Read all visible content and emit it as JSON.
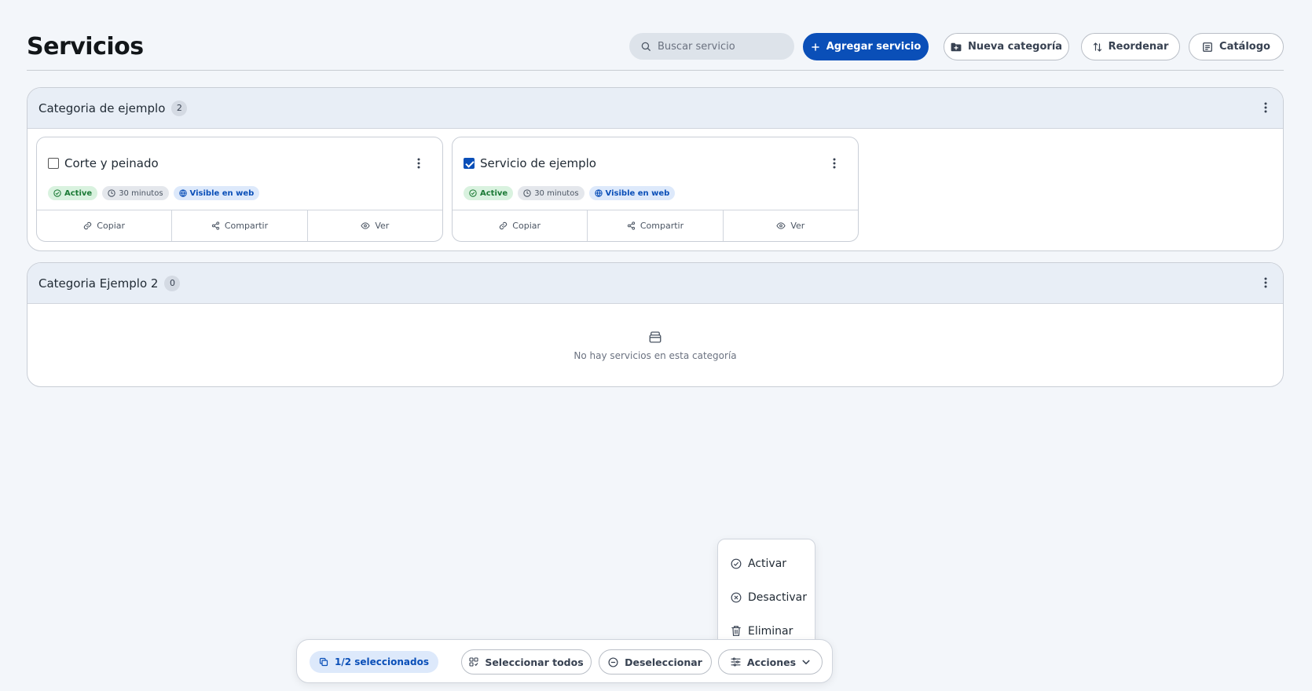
{
  "header": {
    "title": "Servicios",
    "search_placeholder": "Buscar servicio",
    "add_service": "Agregar servicio",
    "new_category": "Nueva categoría",
    "reorder": "Reordenar",
    "catalog": "Catálogo"
  },
  "categories": [
    {
      "title": "Categoria de ejemplo",
      "count": "2",
      "services": [
        {
          "title": "Corte y peinado",
          "checked": false,
          "status": "Active",
          "duration": "30 minutos",
          "visibility": "Visible en web",
          "actions": {
            "copy": "Copiar",
            "share": "Compartir",
            "view": "Ver"
          }
        },
        {
          "title": "Servicio de ejemplo",
          "checked": true,
          "status": "Active",
          "duration": "30 minutos",
          "visibility": "Visible en web",
          "actions": {
            "copy": "Copiar",
            "share": "Compartir",
            "view": "Ver"
          }
        }
      ]
    },
    {
      "title": "Categoria Ejemplo 2",
      "count": "0",
      "empty_text": "No hay servicios en esta categoría"
    }
  ],
  "actions_menu": {
    "items": [
      {
        "label": "Activar",
        "icon": "check-circle-icon"
      },
      {
        "label": "Desactivar",
        "icon": "x-circle-icon"
      },
      {
        "label": "Eliminar",
        "icon": "trash-icon"
      }
    ]
  },
  "selection_bar": {
    "count_label": "1/2 seleccionados",
    "select_all": "Seleccionar todos",
    "deselect": "Deseleccionar",
    "actions": "Acciones"
  },
  "colors": {
    "primary": "#0a4fb8",
    "background": "#f3f6fa",
    "active_green": "#1b7a35",
    "category_header": "#e8eef6"
  }
}
